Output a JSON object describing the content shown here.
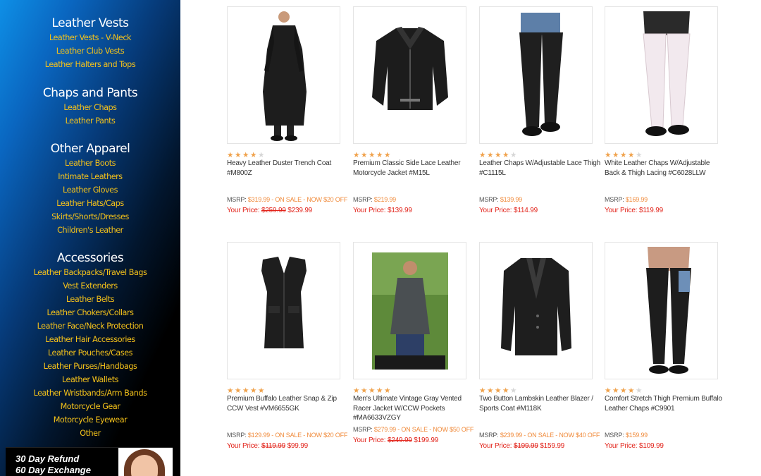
{
  "sidebar": {
    "sections": [
      {
        "heading": "Leather Vests",
        "links": [
          "Leather Vests - V-Neck",
          "Leather Club Vests",
          "Leather Halters and Tops"
        ]
      },
      {
        "heading": "Chaps and Pants",
        "links": [
          "Leather Chaps",
          "Leather Pants"
        ]
      },
      {
        "heading": "Other Apparel",
        "links": [
          "Leather Boots",
          "Intimate Leathers",
          "Leather Gloves",
          "Leather Hats/Caps",
          "Skirts/Shorts/Dresses",
          "Children's Leather"
        ]
      },
      {
        "heading": "Accessories",
        "links": [
          "Leather Backpacks/Travel Bags",
          "Vest Extenders",
          "Leather Belts",
          "Leather Chokers/Collars",
          "Leather Face/Neck Protection",
          "Leather Hair Accessories",
          "Leather Pouches/Cases",
          "Leather Purses/Handbags",
          "Leather Wallets",
          "Leather Wristbands/Arm Bands",
          "Motorcycle Gear",
          "Motorcycle Eyewear",
          "Other"
        ]
      }
    ],
    "promo": {
      "line1": "30 Day Refund",
      "line2": "60 Day Exchange"
    }
  },
  "products": [
    {
      "title": "Heavy Leather Duster Trench Coat #M800Z",
      "rating": 4,
      "msrp_label": "MSRP:",
      "msrp": "$319.99",
      "sale_note": " - ON SALE - NOW $20 OFF",
      "price_label": "Your Price:",
      "old_price": "$259.99",
      "price": "$239.99",
      "image": "leather-duster-trench-coat"
    },
    {
      "title": "Premium Classic Side Lace Leather Motorcycle Jacket #M15L",
      "rating": 5,
      "msrp_label": "MSRP:",
      "msrp": "$219.99",
      "sale_note": "",
      "price_label": "Your Price:",
      "old_price": "",
      "price": "$139.99",
      "image": "motorcycle-jacket"
    },
    {
      "title": "Leather Chaps W/Adjustable Lace Thigh #C1115L",
      "rating": 4,
      "msrp_label": "MSRP:",
      "msrp": "$139.99",
      "sale_note": "",
      "price_label": "Your Price:",
      "old_price": "",
      "price": "$114.99",
      "image": "black-leather-chaps"
    },
    {
      "title": "White Leather Chaps W/Adjustable Back & Thigh Lacing #C6028LLW",
      "rating": 4,
      "msrp_label": "MSRP:",
      "msrp": "$169.99",
      "sale_note": "",
      "price_label": "Your Price:",
      "old_price": "",
      "price": "$119.99",
      "image": "white-leather-chaps"
    },
    {
      "title": "Premium Buffalo Leather Snap & Zip CCW Vest #VM6655GK",
      "rating": 5,
      "msrp_label": "MSRP:",
      "msrp": "$129.99",
      "sale_note": " - ON SALE - NOW $20 OFF",
      "price_label": "Your Price:",
      "old_price": "$119.99",
      "price": "$99.99",
      "image": "leather-vest"
    },
    {
      "title": "Men's Ultimate Vintage Gray Vented Racer Jacket W/CCW Pockets #MA6633VZGY",
      "rating": 5,
      "msrp_label": "MSRP:",
      "msrp": "$279.99",
      "sale_note": " - ON SALE - NOW $50 OFF",
      "price_label": "Your Price:",
      "old_price": "$249.99",
      "price": "$199.99",
      "image": "racer-jacket-photo"
    },
    {
      "title": "Two Button Lambskin Leather Blazer / Sports Coat #M118K",
      "rating": 4,
      "msrp_label": "MSRP:",
      "msrp": "$239.99",
      "sale_note": " - ON SALE - NOW $40 OFF",
      "price_label": "Your Price:",
      "old_price": "$199.99",
      "price": "$159.99",
      "image": "leather-blazer"
    },
    {
      "title": "Comfort Stretch Thigh Premium Buffalo Leather Chaps #C9901",
      "rating": 4,
      "msrp_label": "MSRP:",
      "msrp": "$159.99",
      "sale_note": "",
      "price_label": "Your Price:",
      "old_price": "",
      "price": "$109.99",
      "image": "buffalo-leather-chaps"
    }
  ],
  "colors": {
    "link_gold": "#f4c21a",
    "star_on": "#f0a14a",
    "price_red": "#e2231a",
    "msrp_orange": "#f08a3a"
  }
}
